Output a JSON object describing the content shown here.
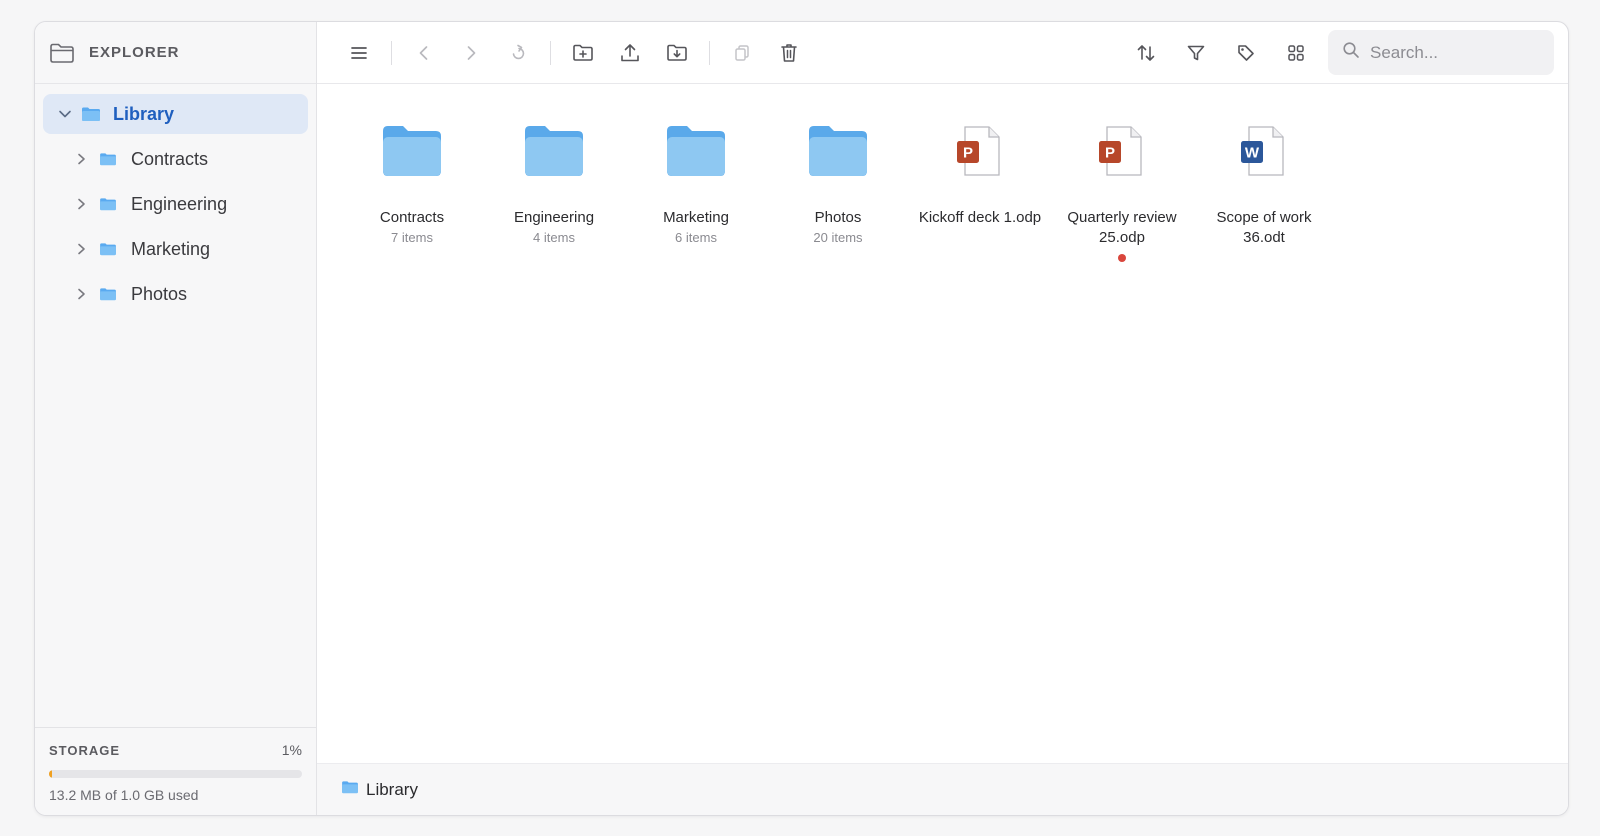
{
  "sidebar": {
    "title": "EXPLORER",
    "root": {
      "label": "Library",
      "icon": "folder-icon"
    },
    "items": [
      {
        "label": "Contracts"
      },
      {
        "label": "Engineering"
      },
      {
        "label": "Marketing"
      },
      {
        "label": "Photos"
      }
    ],
    "storage": {
      "title": "STORAGE",
      "percent_label": "1%",
      "percent": 1,
      "used_label": "13.2 MB of 1.0 GB used"
    }
  },
  "toolbar": {
    "icons": [
      "menu-icon",
      "back-icon",
      "forward-icon",
      "up-icon",
      "new-folder-icon",
      "upload-icon",
      "download-icon",
      "copy-icon",
      "trash-icon",
      "sort-icon",
      "filter-icon",
      "tag-icon",
      "grid-view-icon"
    ],
    "search_placeholder": "Search..."
  },
  "content": {
    "items": [
      {
        "type": "folder",
        "name": "Contracts",
        "meta": "7 items"
      },
      {
        "type": "folder",
        "name": "Engineering",
        "meta": "4 items"
      },
      {
        "type": "folder",
        "name": "Marketing",
        "meta": "6 items"
      },
      {
        "type": "folder",
        "name": "Photos",
        "meta": "20 items"
      },
      {
        "type": "presentation",
        "name": "Kickoff deck 1.odp",
        "badge": "P"
      },
      {
        "type": "presentation",
        "name": "Quarterly review 25.odp",
        "badge": "P",
        "marked": true
      },
      {
        "type": "document",
        "name": "Scope of work 36.odt",
        "badge": "W"
      }
    ]
  },
  "footer": {
    "breadcrumb": "Library"
  },
  "colors": {
    "accent": "#1f5fbf",
    "folder": "#8ec8f2",
    "presentation_badge": "#b7472a",
    "document_badge": "#2b579a",
    "marker": "#d9463c",
    "storage_fill": "#f0a020"
  }
}
